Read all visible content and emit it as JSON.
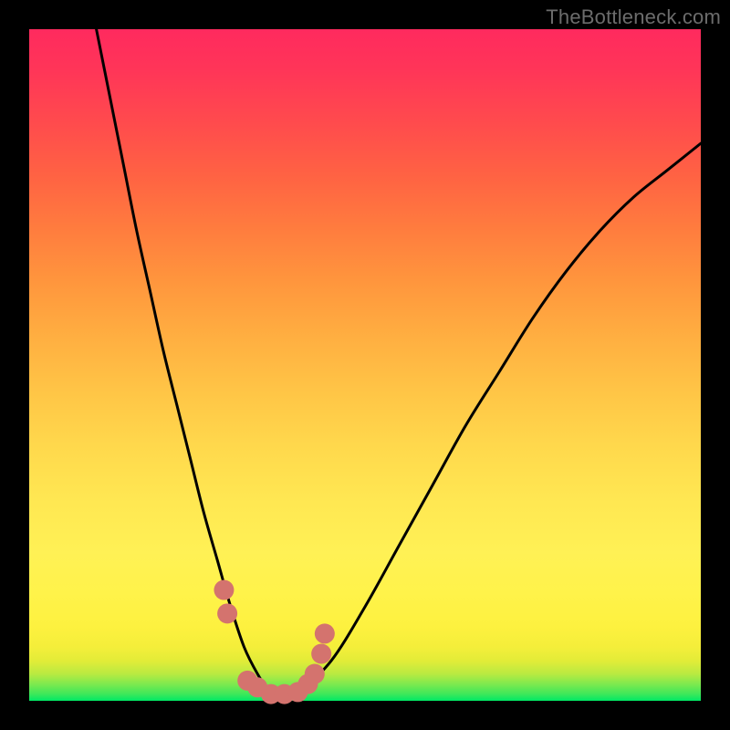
{
  "watermark": "TheBottleneck.com",
  "chart_data": {
    "type": "line",
    "title": "",
    "xlabel": "",
    "ylabel": "",
    "xlim": [
      0,
      100
    ],
    "ylim": [
      0,
      100
    ],
    "series": [
      {
        "name": "bottleneck-curve",
        "x": [
          10,
          12,
          14,
          16,
          18,
          20,
          22,
          24,
          26,
          28,
          30,
          32,
          34,
          36,
          38,
          40,
          45,
          50,
          55,
          60,
          65,
          70,
          75,
          80,
          85,
          90,
          95,
          100
        ],
        "values": [
          100,
          90,
          80,
          70,
          61,
          52,
          44,
          36,
          28,
          21,
          14,
          8,
          4,
          1,
          0,
          1,
          6,
          14,
          23,
          32,
          41,
          49,
          57,
          64,
          70,
          75,
          79,
          83
        ]
      }
    ],
    "markers": {
      "name": "highlight-points",
      "color": "#d4736e",
      "points": [
        {
          "x": 29.0,
          "y": 16.5
        },
        {
          "x": 29.5,
          "y": 13.0
        },
        {
          "x": 32.5,
          "y": 3.0
        },
        {
          "x": 34.0,
          "y": 2.0
        },
        {
          "x": 36.0,
          "y": 1.0
        },
        {
          "x": 38.0,
          "y": 1.0
        },
        {
          "x": 40.0,
          "y": 1.3
        },
        {
          "x": 41.5,
          "y": 2.5
        },
        {
          "x": 42.5,
          "y": 4.0
        },
        {
          "x": 43.5,
          "y": 7.0
        },
        {
          "x": 44.0,
          "y": 10.0
        }
      ]
    }
  },
  "colors": {
    "frame": "#000000",
    "watermark": "#6c6c6c",
    "curve": "#000000",
    "marker": "#d4736e"
  }
}
